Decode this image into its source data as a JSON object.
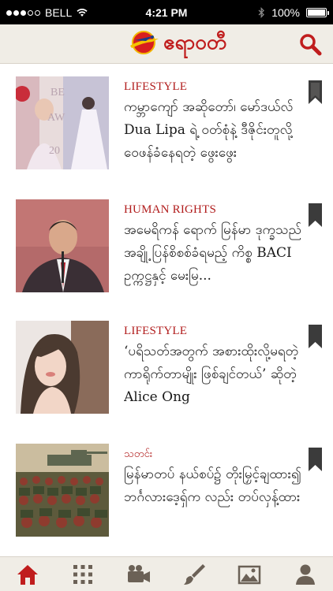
{
  "status_bar": {
    "carrier": "BELL",
    "time": "4:21 PM",
    "battery": "100%",
    "battery_level": 1.0,
    "signal_bars": 3,
    "icons": [
      "wifi-icon",
      "bluetooth-icon",
      "battery-icon"
    ]
  },
  "header": {
    "logo_text": "ဧရာဝတီ",
    "search_icon": "search-icon",
    "accent_color": "#c01d1d"
  },
  "articles": [
    {
      "category": "LIFESTYLE",
      "headline": "ကမ္ဘာကျော် အဆိုတော်၊ မော်ဒယ်လ် Dua Lipa ရဲ့ ဝတ်စုံနဲ့ ဒီဇိုင်းတူလို့ ဝေဖန်ခံနေရတဲ့ ဖွေးဖွေး",
      "thumb_icon": "awards-photo",
      "bookmark_icon": "bookmark-icon"
    },
    {
      "category": "HUMAN RIGHTS",
      "headline": "အမေရိကန် ရောက် မြန်မာ ဒုက္ခသည်အချို့ ပြန်စိစစ်ခံရမည့် ကိစ္စ BACI ဥက္ကဋ္ဌနှင့် မေးမြ...",
      "thumb_icon": "man-portrait-photo",
      "bookmark_icon": "bookmark-icon"
    },
    {
      "category": "LIFESTYLE",
      "headline": "‘ပရိသတ်အတွက် အစားထိုးလို့မရတဲ့ ကာရိုက်တာမျိုး ဖြစ်ချင်တယ်’ ဆိုတဲ့ Alice Ong",
      "thumb_icon": "woman-portrait-photo",
      "bookmark_icon": "bookmark-icon"
    },
    {
      "category": "သတင်း",
      "headline": "မြန်မာတပ် နယ်စပ်၌ တိုးမြှင့်ချထား၍ ဘင်္ဂလားဒေ့ရှ်က လည်း တပ်လှန့်ထား",
      "thumb_icon": "military-parade-photo",
      "bookmark_icon": "bookmark-icon"
    }
  ],
  "tab_bar": {
    "tabs": [
      {
        "icon": "home-icon",
        "active": true
      },
      {
        "icon": "grid-icon",
        "active": false
      },
      {
        "icon": "video-camera-icon",
        "active": false
      },
      {
        "icon": "paintbrush-icon",
        "active": false
      },
      {
        "icon": "image-icon",
        "active": false
      },
      {
        "icon": "profile-icon",
        "active": false
      }
    ],
    "active_color": "#c01d1d",
    "inactive_color": "#6b6156"
  }
}
